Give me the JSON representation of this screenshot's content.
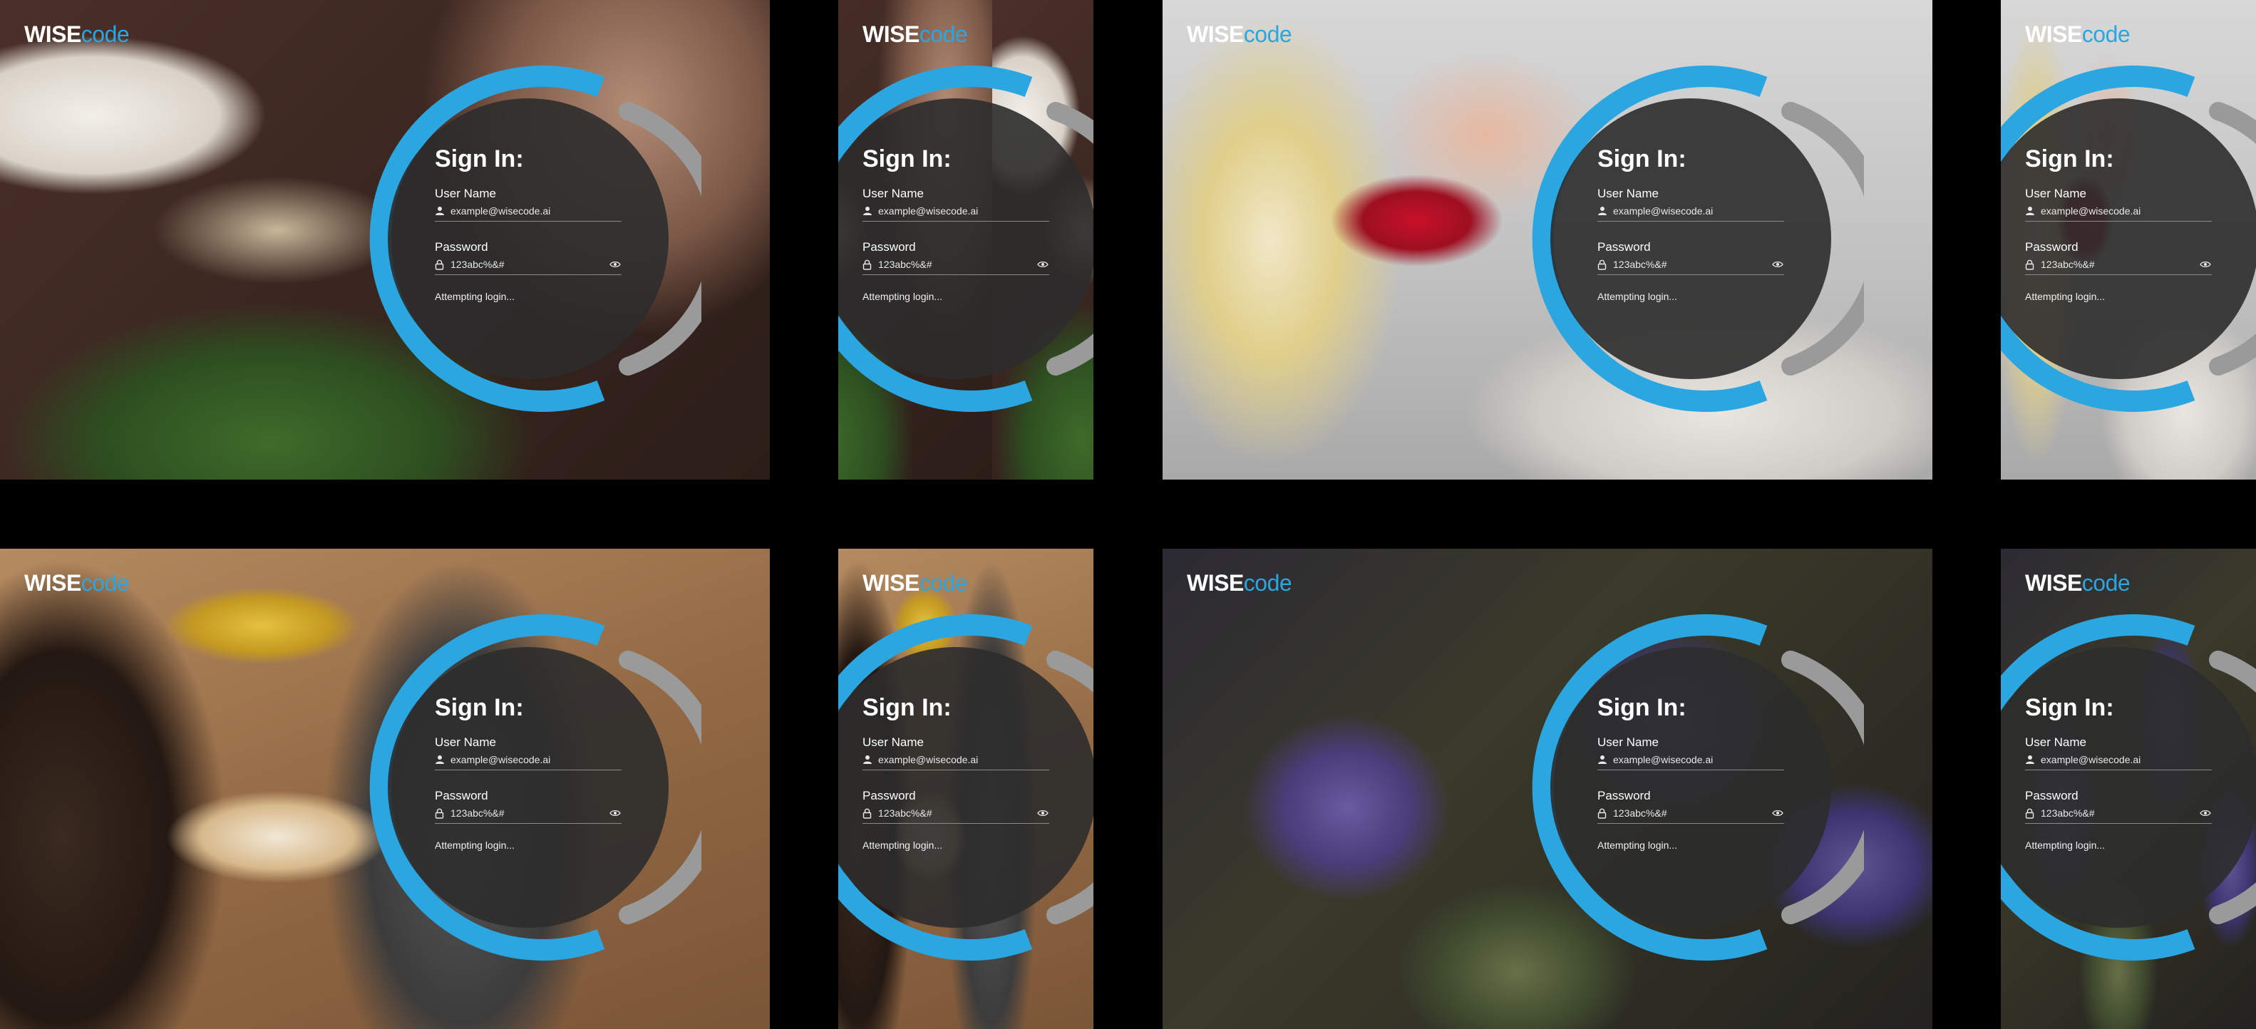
{
  "brand": {
    "logo_wise": "WISE",
    "logo_code": "code",
    "accent_color": "#2ba6e0",
    "grey_arc_color": "#9a9a9a"
  },
  "login": {
    "title": "Sign In:",
    "username_label": "User Name",
    "username_value": "example@wisecode.ai",
    "password_label": "Password",
    "password_value": "123abc%&#",
    "status": "Attempting login..."
  },
  "icons": {
    "username_field": "user-icon",
    "password_field": "lock-icon",
    "password_toggle": "eye-icon"
  },
  "screens": [
    {
      "photo": "salad"
    },
    {
      "photo": "salad"
    },
    {
      "photo": "baby"
    },
    {
      "photo": "baby"
    },
    {
      "photo": "oats"
    },
    {
      "photo": "oats"
    },
    {
      "photo": "artichoke"
    },
    {
      "photo": "artichoke"
    }
  ]
}
